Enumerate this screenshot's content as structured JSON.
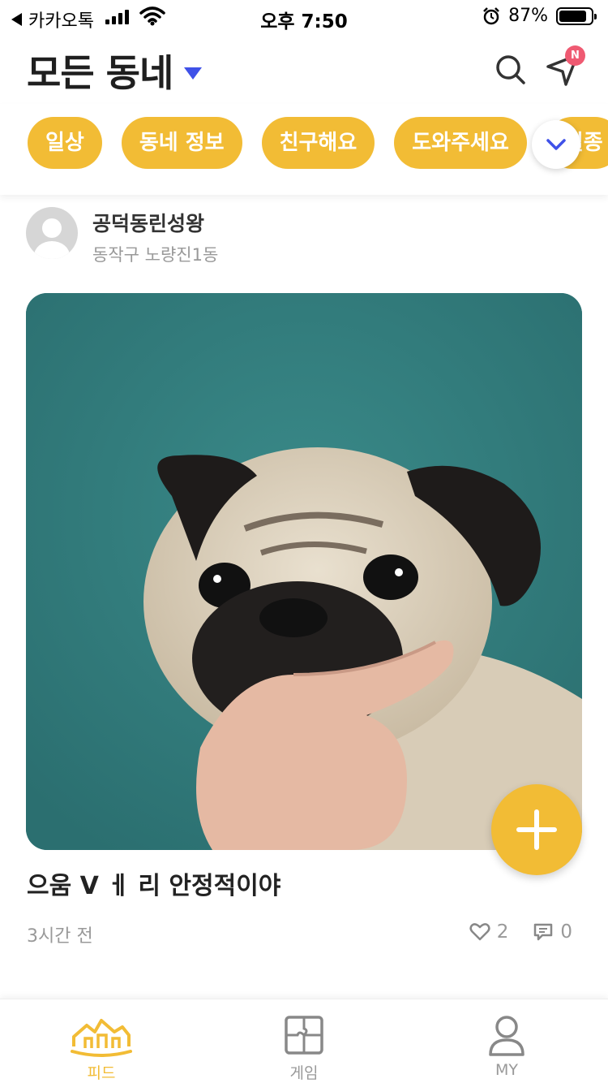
{
  "status_bar": {
    "back_app": "카카오톡",
    "time": "오후 7:50",
    "battery": "87%",
    "battery_level": 0.87
  },
  "header": {
    "title": "모든 동네",
    "badge": "N"
  },
  "categories": [
    "일상",
    "동네 정보",
    "친구해요",
    "도와주세요",
    "실종"
  ],
  "post": {
    "author_name": "공덕동린성왕",
    "author_location": "동작구 노량진1동",
    "title": "으움 V ㅔ 리 안정적이야",
    "time_ago": "3시간 전",
    "likes": "2",
    "comments": "0"
  },
  "bottom_nav": {
    "tabs": [
      {
        "label": "피드",
        "icon": "home-icon",
        "active": true
      },
      {
        "label": "게임",
        "icon": "puzzle-icon",
        "active": false
      },
      {
        "label": "MY",
        "icon": "person-icon",
        "active": false
      }
    ]
  },
  "colors": {
    "accent": "#f2bc35",
    "dropdown": "#3f51e8",
    "badge": "#ef5a72",
    "muted": "#999999"
  }
}
